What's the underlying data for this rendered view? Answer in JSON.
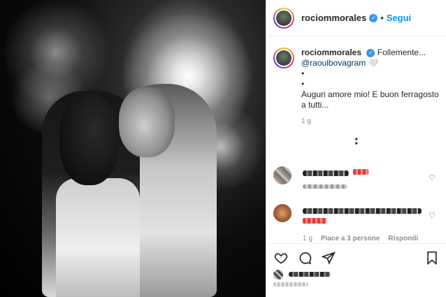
{
  "post": {
    "username": "rociommorales",
    "follow_label": "Segui",
    "dot": "•"
  },
  "caption": {
    "username": "rociommorales",
    "line1": "Follemente...",
    "mention": "@raoulbovagram",
    "heart": "🤍",
    "bullet1": "•",
    "bullet2": "•",
    "body": "Auguri amore mio! E buon ferragosto a tutti...",
    "time": "1 g"
  },
  "comments": [
    {
      "time": "1 g",
      "likes": "Piace a 3 persone",
      "reply": "Rispondi"
    }
  ],
  "icons": {
    "like": "heart-icon",
    "comment": "comment-icon",
    "share": "share-icon",
    "save": "bookmark-icon",
    "more": "more-options-icon"
  },
  "colors": {
    "follow": "#0095f6",
    "verified": "#3897f0",
    "mention": "#00376b",
    "muted": "#8e8e8e"
  }
}
